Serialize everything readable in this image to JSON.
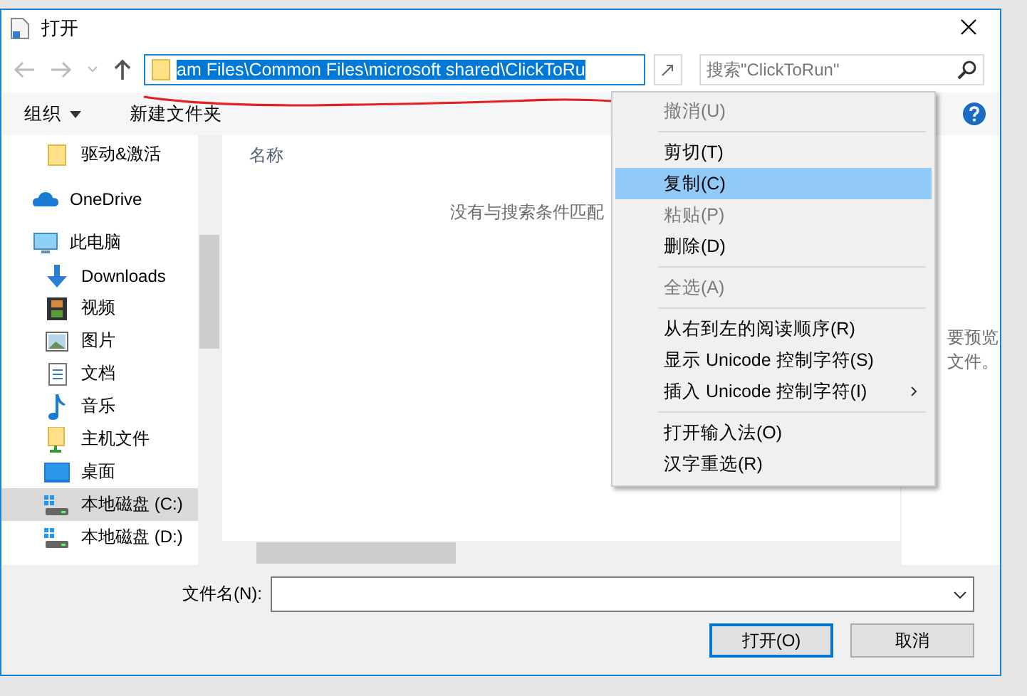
{
  "window": {
    "title": "打开"
  },
  "nav": {
    "address": "am Files\\Common Files\\microsoft shared\\ClickToRu",
    "address_selected": true,
    "search": {
      "placeholder": "搜索\"ClickToRun\""
    }
  },
  "toolbar": {
    "organize": "组织",
    "new_folder": "新建文件夹"
  },
  "sidebar": {
    "items": [
      {
        "label": "驱动&激活",
        "kind": "folder",
        "selected": false
      },
      {
        "label": "OneDrive",
        "kind": "cloud",
        "selected": false
      },
      {
        "label": "此电脑",
        "kind": "pc",
        "selected": false,
        "children": [
          {
            "label": "Downloads",
            "kind": "download",
            "selected": false
          },
          {
            "label": "视频",
            "kind": "video",
            "selected": false
          },
          {
            "label": "图片",
            "kind": "picture",
            "selected": false
          },
          {
            "label": "文档",
            "kind": "document",
            "selected": false
          },
          {
            "label": "音乐",
            "kind": "music",
            "selected": false
          },
          {
            "label": "主机文件",
            "kind": "share",
            "selected": false
          },
          {
            "label": "桌面",
            "kind": "desktop",
            "selected": false
          },
          {
            "label": "本地磁盘 (C:)",
            "kind": "drive",
            "selected": true
          },
          {
            "label": "本地磁盘 (D:)",
            "kind": "drive",
            "selected": false
          }
        ]
      }
    ]
  },
  "content": {
    "column": "名称",
    "empty_message": "没有与搜索条件匹配"
  },
  "preview": {
    "lines": [
      "要预览",
      "文件。"
    ]
  },
  "footer": {
    "filename_label": "文件名(N):",
    "buttons": [
      {
        "label": "打开(O)",
        "default": true
      },
      {
        "label": "取消",
        "default": false
      }
    ]
  },
  "context_menu": {
    "items": [
      {
        "kind": "item",
        "label": "撤消(U)",
        "disabled": true,
        "selected": false
      },
      {
        "kind": "separator"
      },
      {
        "kind": "item",
        "label": "剪切(T)",
        "disabled": false,
        "selected": false
      },
      {
        "kind": "item",
        "label": "复制(C)",
        "disabled": false,
        "selected": true
      },
      {
        "kind": "item",
        "label": "粘贴(P)",
        "disabled": true,
        "selected": false
      },
      {
        "kind": "item",
        "label": "删除(D)",
        "disabled": false,
        "selected": false
      },
      {
        "kind": "separator"
      },
      {
        "kind": "item",
        "label": "全选(A)",
        "disabled": true,
        "selected": false
      },
      {
        "kind": "separator"
      },
      {
        "kind": "item",
        "label": "从右到左的阅读顺序(R)",
        "disabled": false,
        "selected": false
      },
      {
        "kind": "item",
        "label": "显示 Unicode 控制字符(S)",
        "disabled": false,
        "selected": false
      },
      {
        "kind": "submenu",
        "label": "插入 Unicode 控制字符(I)",
        "disabled": false,
        "selected": false
      },
      {
        "kind": "separator"
      },
      {
        "kind": "item",
        "label": "打开输入法(O)",
        "disabled": false,
        "selected": false
      },
      {
        "kind": "item",
        "label": "汉字重选(R)",
        "disabled": false,
        "selected": false
      }
    ]
  }
}
